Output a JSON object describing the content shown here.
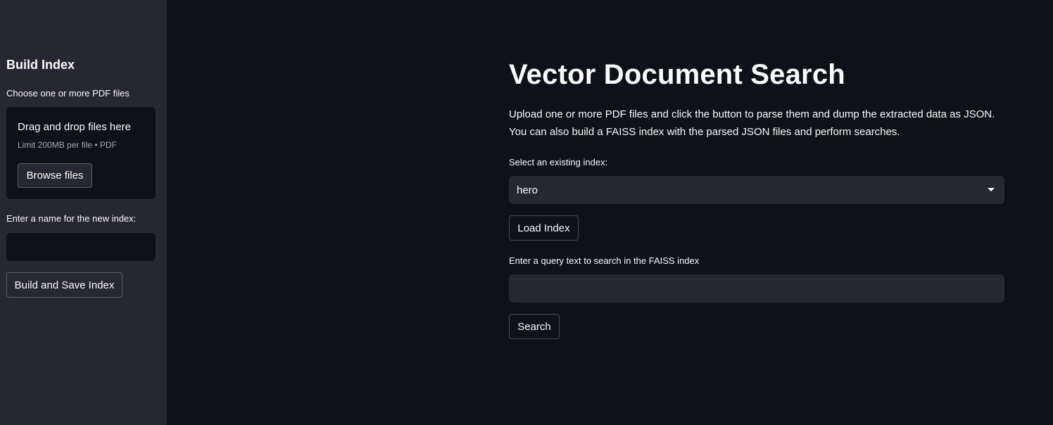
{
  "sidebar": {
    "title": "Build Index",
    "upload_label": "Choose one or more PDF files",
    "dropzone": {
      "title": "Drag and drop files here",
      "subtitle": "Limit 200MB per file • PDF",
      "browse_label": "Browse files"
    },
    "name_label": "Enter a name for the new index:",
    "name_value": "",
    "build_button": "Build and Save Index"
  },
  "main": {
    "title": "Vector Document Search",
    "description_line1": "Upload one or more PDF files and click the button to parse them and dump the extracted data as JSON.",
    "description_line2": "You can also build a FAISS index with the parsed JSON files and perform searches.",
    "select_label": "Select an existing index:",
    "select_value": "hero",
    "load_button": "Load Index",
    "query_label": "Enter a query text to search in the FAISS index",
    "query_value": "",
    "search_button": "Search"
  },
  "colors": {
    "background": "#0e1117",
    "sidebar": "#262730",
    "text": "#fafafa"
  }
}
